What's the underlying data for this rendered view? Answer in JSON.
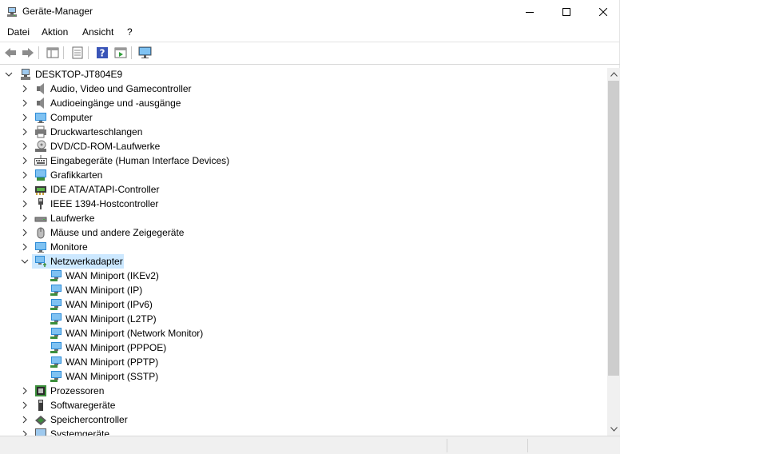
{
  "window": {
    "title": "Geräte-Manager"
  },
  "menu": {
    "items": [
      "Datei",
      "Aktion",
      "Ansicht",
      "?"
    ]
  },
  "toolbar": {
    "buttons": [
      "back-icon",
      "forward-icon",
      "show-hide-console-tree-icon",
      "properties-icon",
      "help-icon",
      "run-icon",
      "scan-hardware-icon"
    ]
  },
  "tree": {
    "root": "DESKTOP-JT804E9",
    "categories": [
      "Audio, Video und Gamecontroller",
      "Audioeingänge und -ausgänge",
      "Computer",
      "Druckwarteschlangen",
      "DVD/CD-ROM-Laufwerke",
      "Eingabegeräte (Human Interface Devices)",
      "Grafikkarten",
      "IDE ATA/ATAPI-Controller",
      "IEEE 1394-Hostcontroller",
      "Laufwerke",
      "Mäuse und andere Zeigegeräte",
      "Monitore",
      "Netzwerkadapter",
      "Prozessoren",
      "Softwaregeräte",
      "Speichercontroller",
      "Systemgeräte"
    ],
    "expanded_category": "Netzwerkadapter",
    "network_adapters": [
      "WAN Miniport (IKEv2)",
      "WAN Miniport (IP)",
      "WAN Miniport (IPv6)",
      "WAN Miniport (L2TP)",
      "WAN Miniport (Network Monitor)",
      "WAN Miniport (PPPOE)",
      "WAN Miniport (PPTP)",
      "WAN Miniport (SSTP)"
    ]
  },
  "colors": {
    "selection": "#cce8ff",
    "monitor_blue": "#2c8ad6",
    "scroll_thumb": "#cdcdcd",
    "statusbar": "#f0f0f0"
  }
}
